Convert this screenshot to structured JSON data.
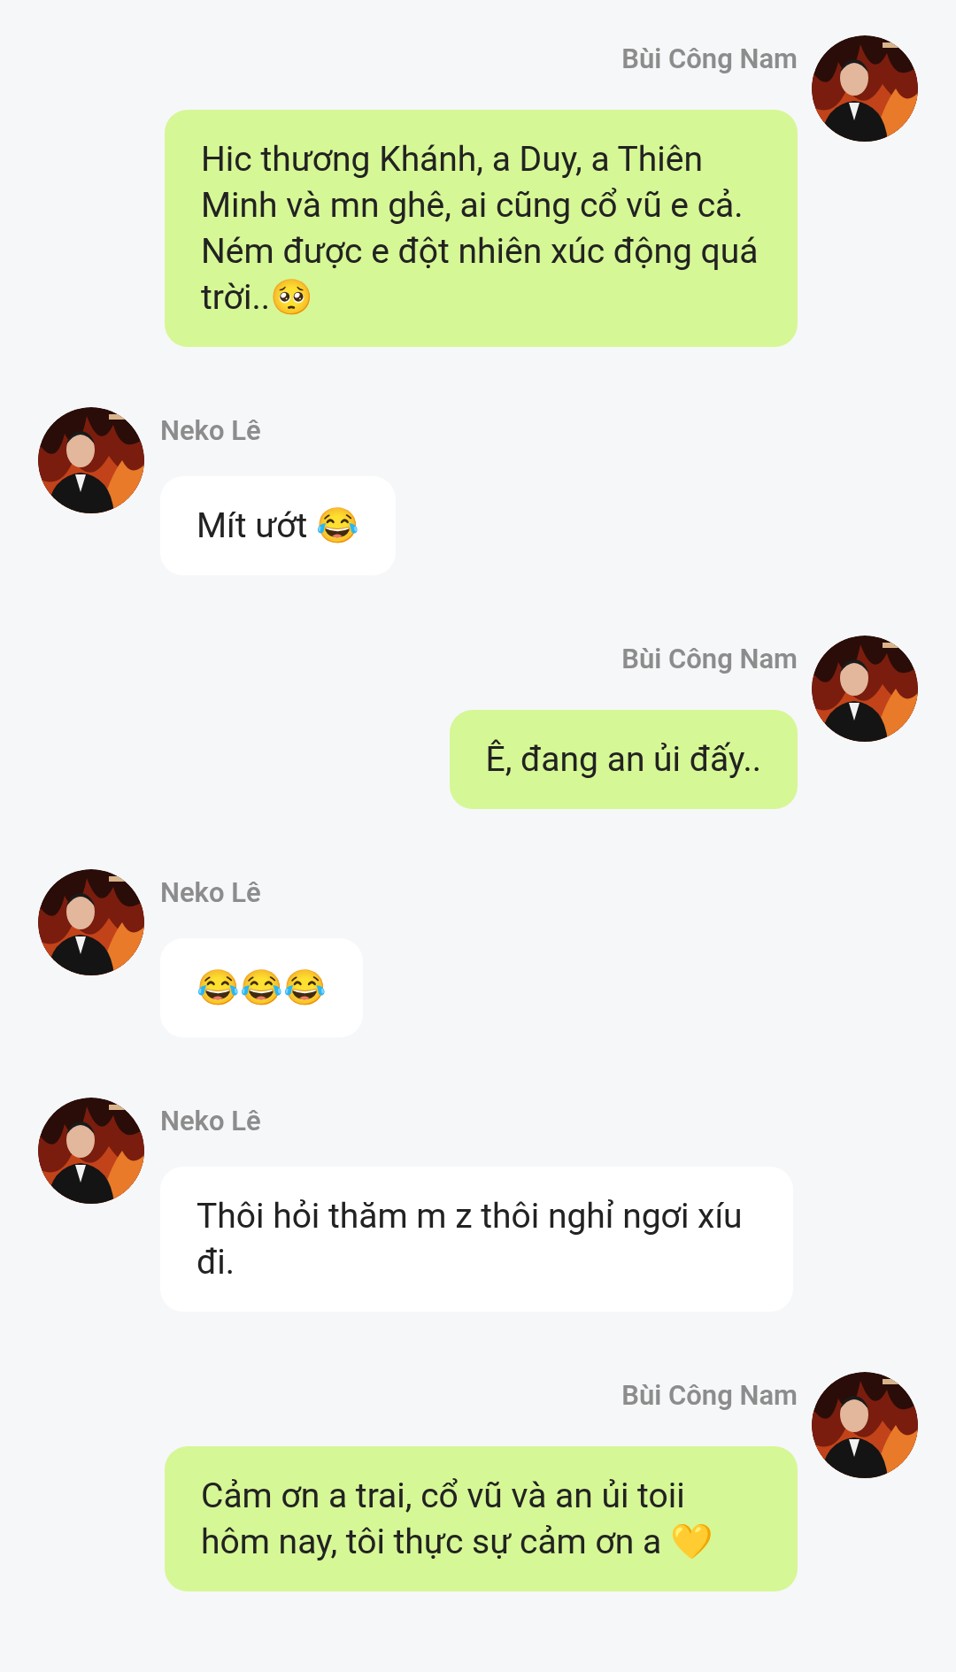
{
  "messages": [
    {
      "kind": "outgoing",
      "sender": "Bùi Công Nam",
      "text": "Hic thương Khánh, a Duy, a Thiên Minh và mn ghê, ai cũng cổ vũ e cả. Ném được e đột nhiên xúc động quá trời..🥺"
    },
    {
      "kind": "incoming",
      "sender": "Neko Lê",
      "text": "Mít ướt 😂"
    },
    {
      "kind": "outgoing",
      "sender": "Bùi Công Nam",
      "text": "Ê, đang an ủi đấy.."
    },
    {
      "kind": "incoming",
      "sender": "Neko Lê",
      "text": "😂😂😂"
    },
    {
      "kind": "incoming",
      "sender": "Neko Lê",
      "text": "Thôi hỏi thăm m z thôi nghỉ ngơi xíu đi."
    },
    {
      "kind": "outgoing",
      "sender": "Bùi Công Nam",
      "text": "Cảm ơn a trai, cổ vũ và an ủi toii hôm nay, tôi thực sự cảm ơn a 💛"
    }
  ]
}
